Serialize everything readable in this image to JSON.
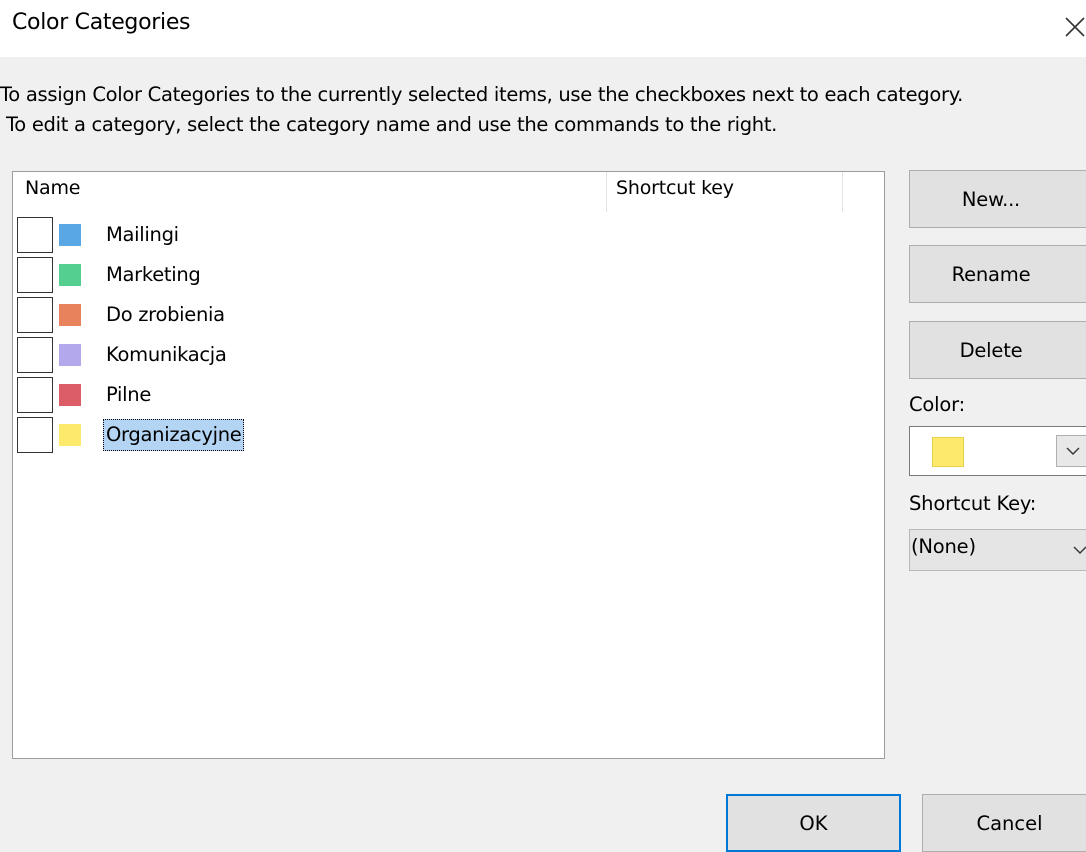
{
  "dialog": {
    "title": "Color Categories",
    "close_icon": "close-icon"
  },
  "description": {
    "line1": "To assign Color Categories to the currently selected items, use the checkboxes next to each category.",
    "line2": "To edit a category, select the category name and use the commands to the right."
  },
  "list": {
    "columns": [
      "Name",
      "Shortcut key"
    ],
    "items": [
      {
        "label": "Mailingi",
        "color": "#5aa7e6",
        "checked": false,
        "selected": false
      },
      {
        "label": "Marketing",
        "color": "#55cf8f",
        "checked": false,
        "selected": false
      },
      {
        "label": "Do zrobienia",
        "color": "#e8825d",
        "checked": false,
        "selected": false
      },
      {
        "label": "Komunikacja",
        "color": "#b4a8ec",
        "checked": false,
        "selected": false
      },
      {
        "label": "Pilne",
        "color": "#dc5c68",
        "checked": false,
        "selected": false
      },
      {
        "label": "Organizacyjne",
        "color": "#fde96b",
        "checked": false,
        "selected": true
      }
    ]
  },
  "side": {
    "new_label": "New...",
    "rename_label": "Rename",
    "delete_label": "Delete",
    "color_label": "Color:",
    "selected_color": "#fde96b",
    "shortcut_key_label": "Shortcut Key:",
    "shortcut_key_value": "(None)"
  },
  "footer": {
    "ok_label": "OK",
    "cancel_label": "Cancel"
  }
}
